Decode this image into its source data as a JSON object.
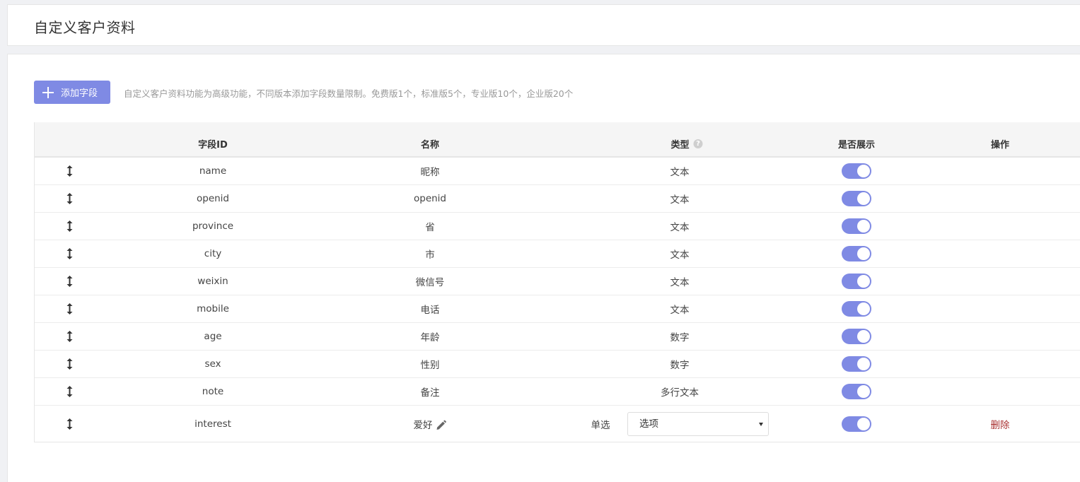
{
  "header": {
    "title": "自定义客户资料"
  },
  "toolbar": {
    "add_label": "添加字段",
    "hint": "自定义客户资料功能为高级功能，不同版本添加字段数量限制。免费版1个，标准版5个，专业版10个，企业版20个"
  },
  "table": {
    "columns": {
      "field_id": "字段ID",
      "name": "名称",
      "type": "类型",
      "type_help": "?",
      "display": "是否展示",
      "action": "操作"
    },
    "rows": [
      {
        "field_id": "name",
        "name": "昵称",
        "type": "文本",
        "display": true
      },
      {
        "field_id": "openid",
        "name": "openid",
        "type": "文本",
        "display": true
      },
      {
        "field_id": "province",
        "name": "省",
        "type": "文本",
        "display": true
      },
      {
        "field_id": "city",
        "name": "市",
        "type": "文本",
        "display": true
      },
      {
        "field_id": "weixin",
        "name": "微信号",
        "type": "文本",
        "display": true
      },
      {
        "field_id": "mobile",
        "name": "电话",
        "type": "文本",
        "display": true
      },
      {
        "field_id": "age",
        "name": "年龄",
        "type": "数字",
        "display": true
      },
      {
        "field_id": "sex",
        "name": "性别",
        "type": "数字",
        "display": true
      },
      {
        "field_id": "note",
        "name": "备注",
        "type": "多行文本",
        "display": true
      }
    ],
    "custom_row": {
      "field_id": "interest",
      "name": "爱好",
      "type": "单选",
      "select_value": "选项",
      "display": true,
      "delete_label": "删除"
    }
  },
  "colors": {
    "accent": "#7f8ae4",
    "danger": "#aa3333"
  }
}
